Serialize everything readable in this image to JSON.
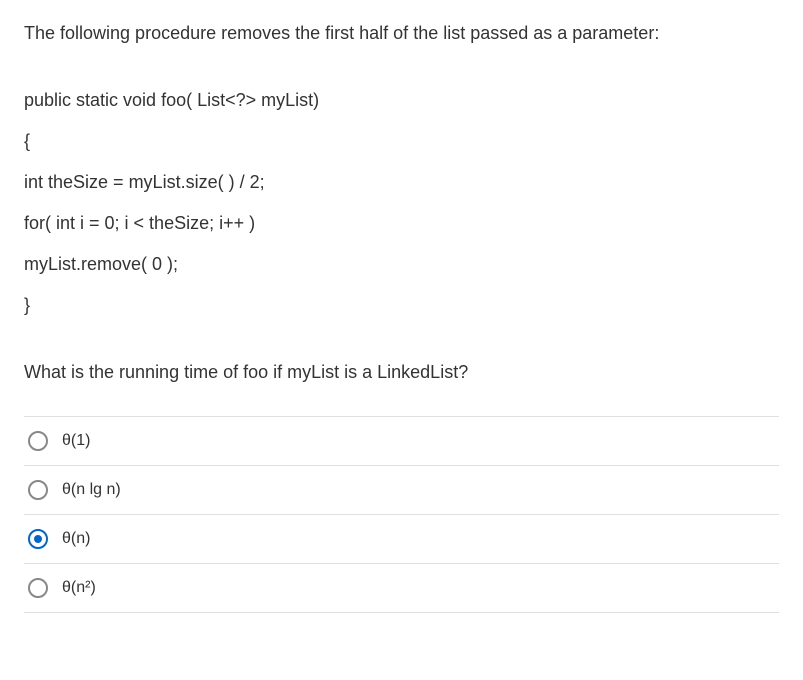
{
  "question": {
    "intro": "The following procedure removes the first half of the list passed as a parameter:",
    "code": [
      "public static void foo( List<?> myList)",
      "{",
      "int theSize = myList.size( ) / 2;",
      "for( int i = 0; i < theSize; i++ )",
      "myList.remove( 0 );",
      "}"
    ],
    "sub": "What is the running time of foo if myList is a LinkedList?"
  },
  "options": [
    {
      "label": "θ(1)",
      "selected": false
    },
    {
      "label": "θ(n lg n)",
      "selected": false
    },
    {
      "label": "θ(n)",
      "selected": true
    },
    {
      "label": "θ(n²)",
      "selected": false
    }
  ]
}
